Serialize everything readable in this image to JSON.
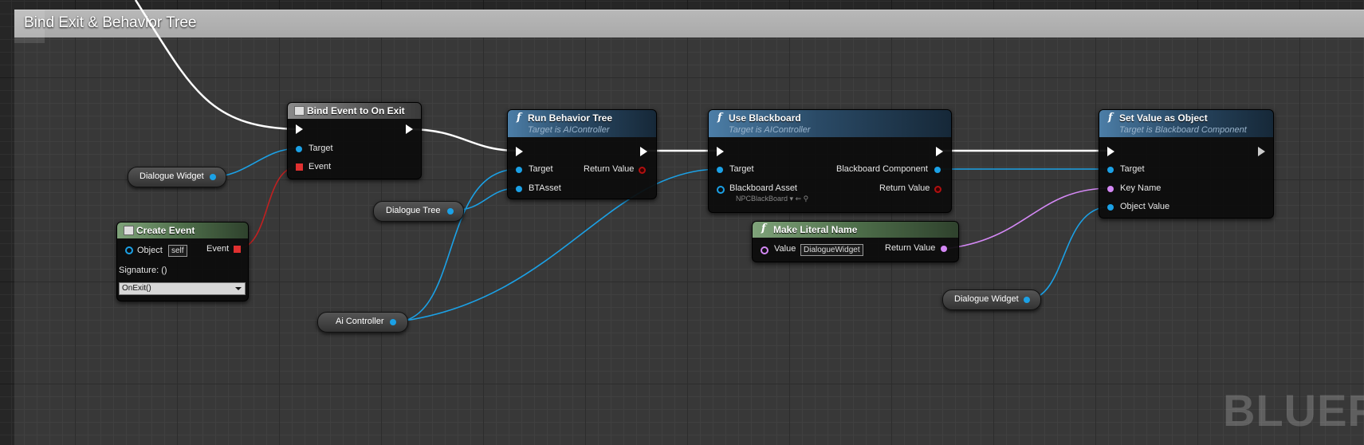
{
  "comment": {
    "title": "Bind Exit & Behavior Tree"
  },
  "watermark": "BLUEPI",
  "nodes": {
    "bind_event": {
      "title": "Bind Event to On Exit",
      "pins": {
        "target": "Target",
        "event": "Event"
      }
    },
    "create_event": {
      "title": "Create Event",
      "object_label": "Object",
      "object_value": "self",
      "event_label": "Event",
      "signature": "Signature: ()",
      "selected_function": "OnExit()"
    },
    "run_behavior_tree": {
      "title": "Run Behavior Tree",
      "subtitle": "Target is AIController",
      "pins": {
        "target": "Target",
        "btasset": "BTAsset",
        "return_value": "Return Value"
      }
    },
    "use_blackboard": {
      "title": "Use Blackboard",
      "subtitle": "Target is AIController",
      "pins": {
        "target": "Target",
        "blackboard_asset": "Blackboard Asset",
        "asset_value": "NPCBlackBoard",
        "blackboard_component": "Blackboard Component",
        "return_value": "Return Value"
      }
    },
    "make_literal_name": {
      "title": "Make Literal Name",
      "value_label": "Value",
      "value": "DialogueWidget",
      "return_value": "Return Value"
    },
    "set_value_as_object": {
      "title": "Set Value as Object",
      "subtitle": "Target is Blackboard Component",
      "pins": {
        "target": "Target",
        "key_name": "Key Name",
        "object_value": "Object Value"
      }
    }
  },
  "variables": {
    "dialogue_widget_1": "Dialogue Widget",
    "dialogue_tree": "Dialogue Tree",
    "ai_controller": "Ai Controller",
    "dialogue_widget_2": "Dialogue Widget"
  },
  "colors": {
    "object_pin": "#1ba1e6",
    "name_pin": "#d488f5",
    "delegate_pin": "#e03030",
    "exec_wire": "#ffffff",
    "function_header": "#4c7ea7",
    "event_header": "#7fa37a"
  }
}
